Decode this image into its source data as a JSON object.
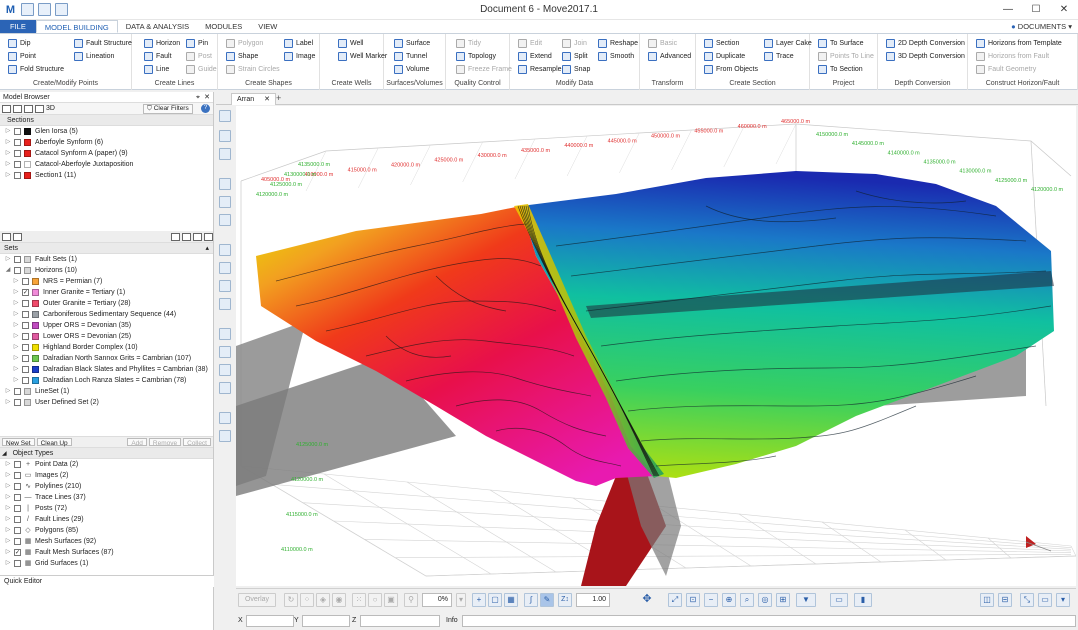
{
  "window": {
    "title": "Document 6 - Move2017.1"
  },
  "tabs": {
    "file": "FILE",
    "items": [
      "MODEL BUILDING",
      "DATA & ANALYSIS",
      "MODULES",
      "VIEW"
    ],
    "documents": "DOCUMENTS"
  },
  "ribbon": {
    "g1": {
      "label": "Create/Modify Points",
      "items": [
        "Dip",
        "Point",
        "Fold Structure",
        "Fault Structure",
        "Lineation"
      ]
    },
    "g2": {
      "label": "Create Lines",
      "items": [
        "Horizon",
        "Fault",
        "Line",
        "Pin",
        "Post",
        "Guide"
      ]
    },
    "g3": {
      "label": "Create Shapes",
      "items": [
        "Polygon",
        "Shape",
        "Strain Circles",
        "Label",
        "Image"
      ]
    },
    "g4": {
      "label": "Create Wells",
      "items": [
        "Well",
        "Well Marker"
      ]
    },
    "g5": {
      "label": "Surfaces/Volumes",
      "items": [
        "Surface",
        "Tunnel",
        "Volume"
      ]
    },
    "g6": {
      "label": "Quality Control",
      "items": [
        "Tidy",
        "Topology",
        "Freeze Frame"
      ]
    },
    "g7": {
      "label": "Modify Data",
      "items": [
        "Edit",
        "Extend",
        "Resample",
        "Join",
        "Split",
        "Snap",
        "Reshape",
        "Smooth"
      ]
    },
    "g8": {
      "label": "Transform",
      "items": [
        "Basic",
        "Advanced"
      ]
    },
    "g9": {
      "label": "Create Section",
      "items": [
        "Section",
        "Duplicate",
        "From Objects",
        "Layer Cake",
        "Trace"
      ]
    },
    "g10": {
      "label": "Project",
      "items": [
        "To Surface",
        "Points To Line",
        "To Section"
      ]
    },
    "g11": {
      "label": "Depth Conversion",
      "items": [
        "2D Depth Conversion",
        "3D Depth Conversion"
      ]
    },
    "g12": {
      "label": "Construct Horizon/Fault",
      "items": [
        "Horizons from Template",
        "Horizons from Fault",
        "Fault Geometry"
      ]
    }
  },
  "model_browser": {
    "title": "Model Browser",
    "view_3d": "3D",
    "clear_filters": "Clear Filters",
    "sections_header": "Sections",
    "sections": [
      {
        "label": "Glen Iorsa (5)",
        "color": "#111111"
      },
      {
        "label": "Aberfoyle Synform (6)",
        "color": "#e8201c"
      },
      {
        "label": "Catacol Synform A (paper) (9)",
        "color": "#e8201c"
      },
      {
        "label": "Catacol-Aberfoyle Juxtaposition",
        "color": "#ffffff"
      },
      {
        "label": "Section1 (11)",
        "color": "#e8201c"
      }
    ]
  },
  "sets": {
    "header": "Sets",
    "items": [
      {
        "label": "Fault Sets (1)",
        "level": 0,
        "exp": "▷"
      },
      {
        "label": "Horizons (10)",
        "level": 0,
        "exp": "◢"
      },
      {
        "label": "NRS = Permian  (7)",
        "level": 1,
        "color": "#f7a43a"
      },
      {
        "label": "Inner Granite = Tertiary (1)",
        "level": 1,
        "color": "#f08ad8",
        "checked": true
      },
      {
        "label": "Outer Granite = Tertiary (28)",
        "level": 1,
        "color": "#f04a6a"
      },
      {
        "label": "Carboniferous Sedimentary Sequence (44)",
        "level": 1,
        "color": "#9aa0a6"
      },
      {
        "label": "Upper ORS = Devonian (35)",
        "level": 1,
        "color": "#c04ac0"
      },
      {
        "label": "Lower ORS = Devonian (25)",
        "level": 1,
        "color": "#e05aa0"
      },
      {
        "label": "Highland Border Complex (10)",
        "level": 1,
        "color": "#f0e000"
      },
      {
        "label": "Dalradian North Sannox Grits = Cambrian (107)",
        "level": 1,
        "color": "#6ec850"
      },
      {
        "label": "Dalradian Black Slates and Phyllites = Cambrian (38)",
        "level": 1,
        "color": "#1a3ec8"
      },
      {
        "label": "Dalradian Loch Ranza Slates = Cambrian (78)",
        "level": 1,
        "color": "#2aa0e0"
      },
      {
        "label": "LineSet (1)",
        "level": 0,
        "exp": "▷"
      },
      {
        "label": "User Defined Set (2)",
        "level": 0,
        "exp": "▷"
      }
    ],
    "buttons": [
      "New Set",
      "Clean Up",
      "Add",
      "Remove",
      "Collect"
    ]
  },
  "object_types": {
    "header": "Object Types",
    "items": [
      {
        "label": "Point Data (2)",
        "icon": "+"
      },
      {
        "label": "Images (2)",
        "icon": "▭"
      },
      {
        "label": "Polylines (210)",
        "icon": "∿"
      },
      {
        "label": "Trace Lines (37)",
        "icon": "—"
      },
      {
        "label": "Posts (72)",
        "icon": "|"
      },
      {
        "label": "Fault Lines (29)",
        "icon": "/"
      },
      {
        "label": "Polygons (85)",
        "icon": "◇"
      },
      {
        "label": "Mesh Surfaces (92)",
        "icon": "▦"
      },
      {
        "label": "Fault Mesh Surfaces (87)",
        "icon": "▦",
        "checked": true
      },
      {
        "label": "Grid Surfaces (1)",
        "icon": "▦"
      }
    ]
  },
  "quick_editor": "Quick Editor",
  "viewport": {
    "tab_label": "Arran",
    "top_axis_labels": [
      "405000.0 m",
      "410000.0 m",
      "415000.0 m",
      "420000.0 m",
      "425000.0 m",
      "430000.0 m",
      "435000.0 m",
      "440000.0 m",
      "445000.0 m",
      "450000.0 m",
      "455000.0 m",
      "460000.0 m",
      "465000.0 m"
    ],
    "right_axis_labels": [
      "4150000.0 m",
      "4145000.0 m",
      "4140000.0 m",
      "4135000.0 m",
      "4130000.0 m",
      "4125000.0 m",
      "4120000.0 m"
    ],
    "left_axis_labels": [
      "4120000.0 m",
      "4125000.0 m",
      "4130000.0 m",
      "4135000.0 m"
    ],
    "bottom_axis_labels": [
      "4110000.0 m",
      "4115000.0 m",
      "4120000.0 m",
      "4125000.0 m"
    ]
  },
  "bottom_toolbar": {
    "overlay": "Overlay",
    "opacity": "0%",
    "scale": "1.00"
  },
  "status": {
    "x": "X",
    "y": "Y",
    "z": "Z",
    "info": "Info"
  }
}
